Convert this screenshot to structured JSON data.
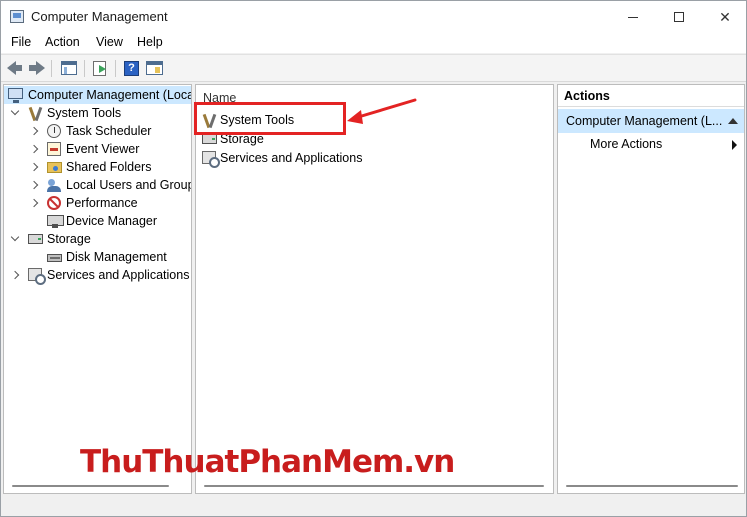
{
  "window": {
    "title": "Computer Management"
  },
  "menu": {
    "items": [
      "File",
      "Action",
      "View",
      "Help"
    ]
  },
  "tree": {
    "root_label": "Computer Management (Local",
    "items": [
      {
        "label": "System Tools",
        "icon": "tools-icon"
      },
      {
        "label": "Task Scheduler",
        "icon": "clock-icon"
      },
      {
        "label": "Event Viewer",
        "icon": "event-viewer-icon"
      },
      {
        "label": "Shared Folders",
        "icon": "shared-folder-icon"
      },
      {
        "label": "Local Users and Groups",
        "icon": "users-icon"
      },
      {
        "label": "Performance",
        "icon": "performance-icon"
      },
      {
        "label": "Device Manager",
        "icon": "device-manager-icon"
      },
      {
        "label": "Storage",
        "icon": "storage-icon"
      },
      {
        "label": "Disk Management",
        "icon": "disk-icon"
      },
      {
        "label": "Services and Applications",
        "icon": "services-icon"
      }
    ]
  },
  "list": {
    "column_header": "Name",
    "rows": [
      "System Tools",
      "Storage",
      "Services and Applications"
    ]
  },
  "actions": {
    "header": "Actions",
    "section_label": "Computer Management (L...",
    "more_actions": "More Actions"
  },
  "watermark": {
    "part_a": "ThuThuat",
    "part_b": "PhanMem",
    "part_c": ".vn"
  },
  "colors": {
    "highlight": "#e32323",
    "selection": "#cce8ff",
    "watermark": "#c81d1d"
  }
}
